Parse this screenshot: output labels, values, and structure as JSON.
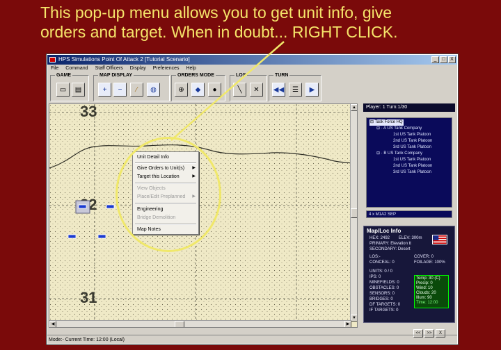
{
  "caption": {
    "line1": "This pop-up menu allows you to get unit info, give",
    "line2": "orders and target.  When in doubt... RIGHT CLICK."
  },
  "window": {
    "title": "HPS Simulations Point Of Attack 2 [Tutorial Scenario]",
    "controls": {
      "minimize": "_",
      "maximize": "□",
      "close": "X"
    }
  },
  "menubar": [
    "File",
    "Command",
    "Staff Officers",
    "Display",
    "Preferences",
    "Help"
  ],
  "toolbar": {
    "groups": [
      "GAME",
      "MAP DISPLAY",
      "ORDERS MODE",
      "LOS",
      "TURN"
    ],
    "icons": [
      "window-icon",
      "disk-icon",
      "zoom-in-icon",
      "zoom-out-icon",
      "ruler-icon",
      "globe-icon",
      "crosshair-icon",
      "move-icon",
      "stop-icon",
      "los-icon",
      "los-clear-icon",
      "rewind-icon",
      "menu-icon",
      "play-icon"
    ]
  },
  "map": {
    "hex_labels": [
      "33",
      "32",
      "31"
    ]
  },
  "popup_menu": {
    "items": [
      {
        "label": "Unit Detail Info",
        "enabled": true,
        "submenu": false
      },
      {
        "label": "Give Orders to Unit(s)",
        "enabled": true,
        "submenu": true
      },
      {
        "label": "Target this Location",
        "enabled": true,
        "submenu": true
      },
      {
        "label": "View Objects",
        "enabled": false,
        "submenu": false
      },
      {
        "label": "Place/Edit Preplanned",
        "enabled": false,
        "submenu": true
      },
      {
        "label": "Engineering",
        "enabled": true,
        "submenu": false
      },
      {
        "label": "Bridge Demolition",
        "enabled": false,
        "submenu": false
      },
      {
        "label": "Map Notes",
        "enabled": true,
        "submenu": false
      }
    ],
    "submenu_arrow": "▶"
  },
  "side_panel": {
    "player_turn": "Player: 1  Turn:1/30",
    "tree": [
      {
        "label": "Task Force HQ",
        "level": 0,
        "selected": true,
        "toggle": "⊟"
      },
      {
        "label": "A US Tank Company",
        "level": 1,
        "toggle": "⊟"
      },
      {
        "label": "1st US Tank Platoon",
        "level": 2
      },
      {
        "label": "2nd US Tank Platoon",
        "level": 2
      },
      {
        "label": "3rd US Tank Platoon",
        "level": 2
      },
      {
        "label": "B US Tank Company",
        "level": 1,
        "toggle": "⊟"
      },
      {
        "label": "1st US Tank Platoon",
        "level": 2
      },
      {
        "label": "2nd US Tank Platoon",
        "level": 2
      },
      {
        "label": "3rd US Tank Platoon",
        "level": 2
      }
    ],
    "unit_box": "4 x M1A2 SEP",
    "map_info": {
      "title": "Map/Loc Info",
      "hex": "HEX: 2492",
      "elev": "ELEV: 300m",
      "primary": "PRIMARY: Elevation tt",
      "secondary": "SECONDARY: Desert",
      "los": "LOS:-",
      "cover": "COVER: 0",
      "conceal": "CONCEAL: 0",
      "foliage": "FOILAGE: 100%",
      "units": "UNITS: 0 / 0",
      "ips": "IPS: 0",
      "minefields": "MINEFIELDS: 0",
      "obstacles": "OBSTACLES: 0",
      "sensors": "SENSORS: 0",
      "bridges": "BRIDGES: 0",
      "df_targets": "DF TARGETS: 0",
      "if_targets": "IF TARGETS: 0"
    },
    "weather": {
      "temp": "Temp: 30 (C)",
      "precip": "Precip: 0",
      "wind": "Wind: 10",
      "clouds": "Clouds: 20",
      "illum": "Illum: 90",
      "time": "Time: 12:00"
    },
    "nav": [
      "<<",
      ">>",
      "X"
    ]
  },
  "status_bar": "Mode:- Current Time: 12:00 (Local)",
  "colors": {
    "background": "#7a0a0a",
    "caption": "#f5e46a",
    "highlight_ring": "#f0e86a",
    "titlebar": "#0a246a"
  }
}
